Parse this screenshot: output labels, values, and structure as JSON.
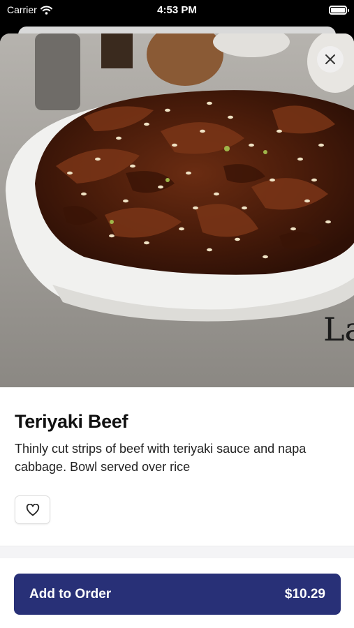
{
  "status_bar": {
    "carrier": "Carrier",
    "time": "4:53 PM"
  },
  "item": {
    "title": "Teriyaki Beef",
    "description": "Thinly cut strips of beef with teriyaki sauce and napa cabbage. Bowl served over rice",
    "image_signage_text": "La"
  },
  "order": {
    "label": "Add to Order",
    "price": "$10.29"
  },
  "colors": {
    "accent": "#283077",
    "background": "#ffffff"
  },
  "icons": [
    "wifi-icon",
    "battery-icon",
    "close-icon",
    "heart-icon"
  ]
}
